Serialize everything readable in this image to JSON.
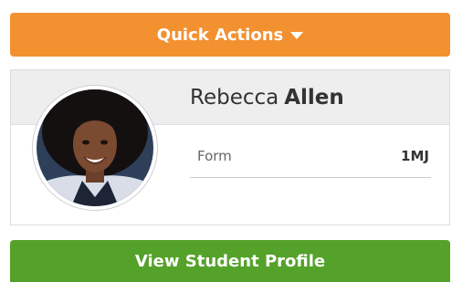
{
  "quick_actions": {
    "label": "Quick Actions",
    "color": "#f39130",
    "icon": "caret-down-icon"
  },
  "student": {
    "first_name": "Rebecca",
    "last_name": "Allen",
    "avatar_icon": "student-photo",
    "details": [
      {
        "label": "Form",
        "value": "1MJ"
      }
    ]
  },
  "view_profile": {
    "label": "View Student Profile",
    "color": "#55a22a"
  }
}
